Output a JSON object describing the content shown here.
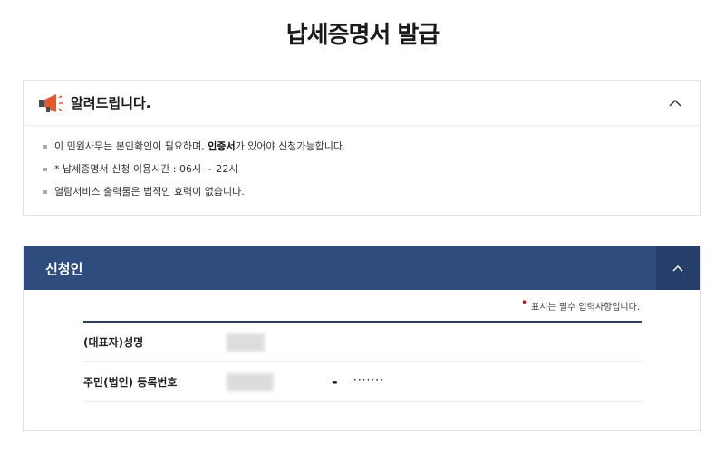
{
  "page": {
    "title": "납세증명서 발급"
  },
  "notice": {
    "title": "알려드립니다.",
    "items": [
      {
        "before": "이 민원사무는 본인확인이 필요하며, ",
        "bold": "인증서",
        "after": "가 있어야 신청가능합니다."
      },
      {
        "text": "* 납세증명서 신청 이용시간 : 06시 ~ 22시"
      },
      {
        "text": "열람서비스 출력물은 법적인 효력이 없습니다."
      }
    ]
  },
  "applicant": {
    "title": "신청인",
    "required_note": "표시는 필수 입력사항입니다.",
    "fields": [
      {
        "label": "(대표자)성명"
      },
      {
        "label": "주민(법인) 등록번호",
        "separator": "-",
        "masked": "·······"
      }
    ]
  },
  "colors": {
    "header_bg": "#2e4c7d",
    "required_dot": "#d40000",
    "megaphone": "#e8562a"
  }
}
